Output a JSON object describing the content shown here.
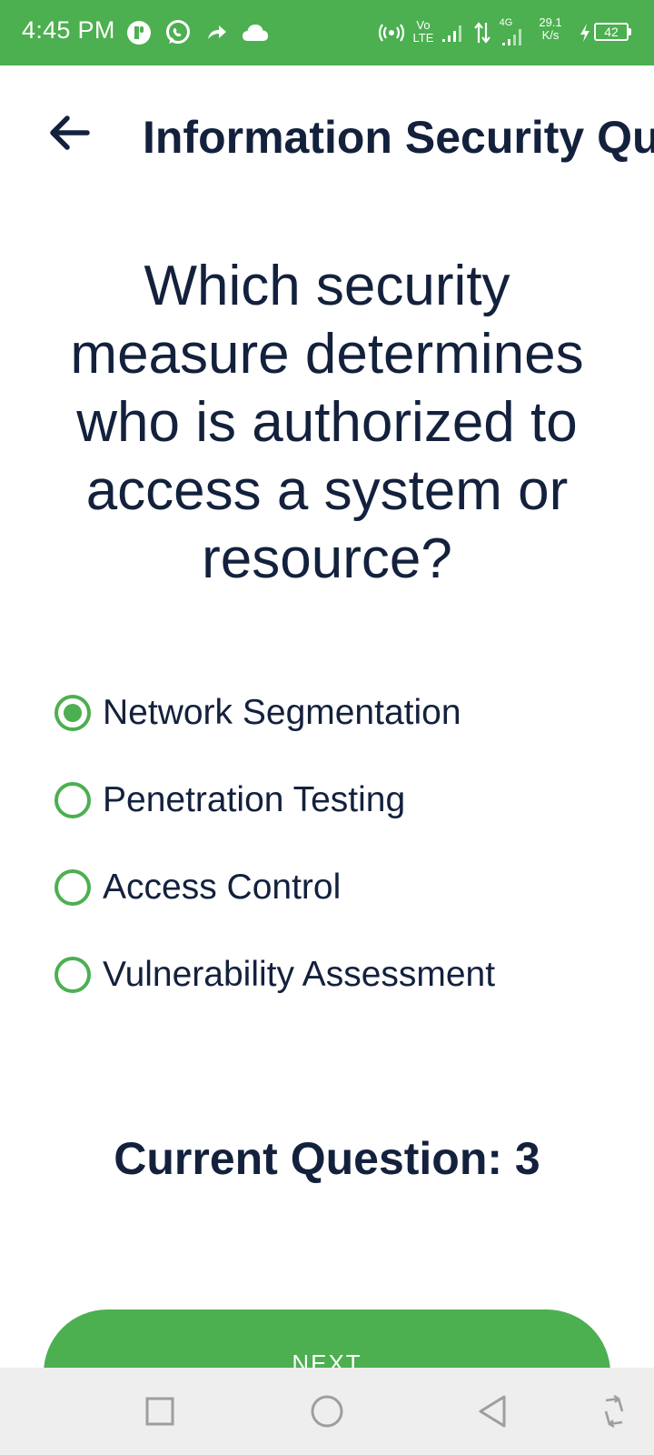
{
  "status_bar": {
    "time": "4:45 PM",
    "volte_top": "Vo",
    "volte_bottom": "LTE",
    "network_type": "4G",
    "speed_value": "29.1",
    "speed_unit": "K/s",
    "battery_level": "42"
  },
  "app_bar": {
    "title": "Information Security Quiz"
  },
  "question": {
    "text": "Which security measure determines who is authorized to access a system or resource?"
  },
  "options": [
    {
      "label": "Network Segmentation",
      "selected": true
    },
    {
      "label": "Penetration Testing",
      "selected": false
    },
    {
      "label": "Access Control",
      "selected": false
    },
    {
      "label": "Vulnerability Assessment",
      "selected": false
    }
  ],
  "progress": {
    "current_question_label": "Current Question: 3"
  },
  "actions": {
    "next_label": "NEXT"
  },
  "colors": {
    "accent": "#4caf50",
    "text_primary": "#13213d",
    "nav_bar_bg": "#eeeeee"
  },
  "icons": {
    "back": "arrow-left-icon",
    "nav_recents": "square-icon",
    "nav_home": "circle-icon",
    "nav_back": "triangle-left-icon",
    "nav_rotate": "rotate-icon"
  }
}
